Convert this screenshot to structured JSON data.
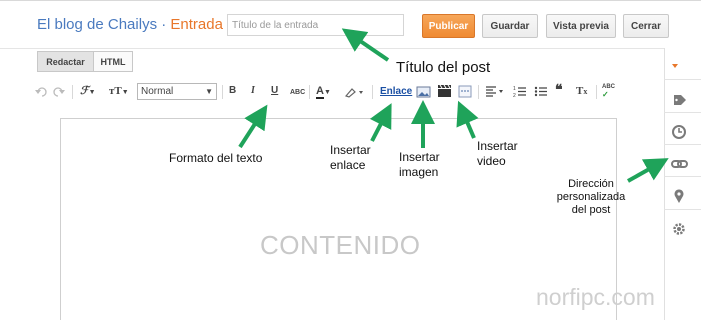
{
  "header": {
    "blog_name": "El blog de Chailys",
    "separator": "·",
    "section": "Entrada",
    "title_placeholder": "Título de la entrada",
    "buttons": {
      "publish": "Publicar",
      "save": "Guardar",
      "preview": "Vista previa",
      "close": "Cerrar"
    }
  },
  "mode_tabs": {
    "compose": "Redactar",
    "html": "HTML"
  },
  "toolbar": {
    "paragraph_style": "Normal",
    "link_label": "Enlace",
    "icons": [
      "undo-icon",
      "redo-icon",
      "font-family-icon",
      "font-size-icon",
      "bold-icon",
      "italic-icon",
      "underline-icon",
      "strikethrough-icon",
      "text-color-icon",
      "highlight-color-icon",
      "link",
      "image-icon",
      "video-icon",
      "jump-break-icon",
      "align-icon",
      "numbered-list-icon",
      "bulleted-list-icon",
      "quote-icon",
      "clear-formatting-icon",
      "spellcheck-icon"
    ]
  },
  "editor": {
    "placeholder_text": "CONTENIDO"
  },
  "sidebar": {
    "icons": [
      "settings-expand-icon",
      "labels-icon",
      "schedule-icon",
      "permalink-icon",
      "location-icon",
      "options-icon"
    ]
  },
  "annotations": {
    "post_title": "Título del post",
    "text_format": "Formato del texto",
    "insert_link": [
      "Insertar",
      "enlace"
    ],
    "insert_image": [
      "Insertar",
      "imagen"
    ],
    "insert_video": [
      "Insertar",
      "video"
    ],
    "custom_url": [
      "Dirección",
      "personalizada",
      "del post"
    ]
  },
  "watermark": "norfipc.com",
  "colors": {
    "accent_orange": "#ef8a32",
    "blog_blue": "#4a7abf",
    "arrow_green": "#1fa35a",
    "link_blue": "#1a4fa3"
  }
}
